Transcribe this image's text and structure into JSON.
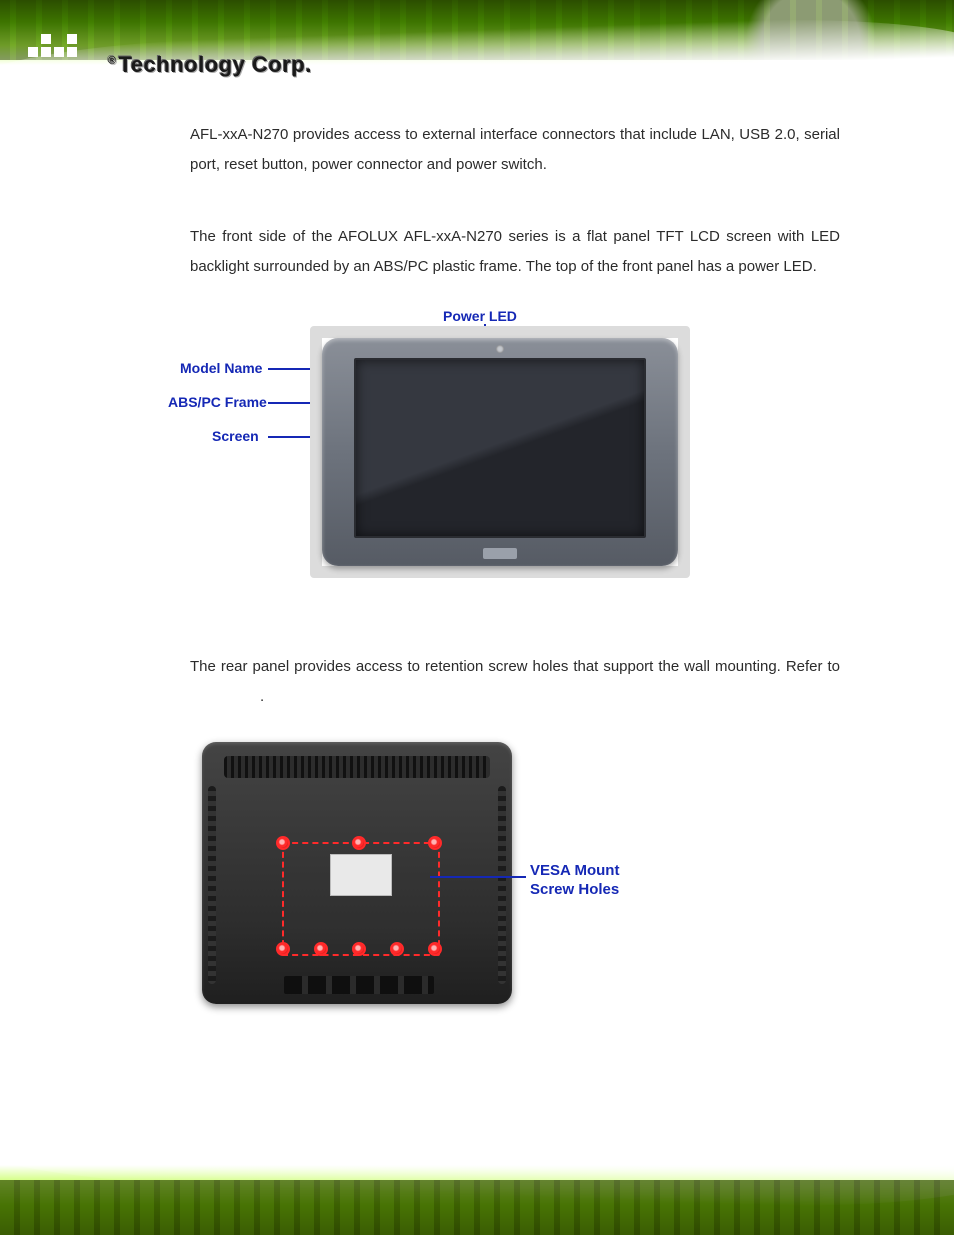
{
  "brand": {
    "name": "Technology Corp.",
    "reg": "®"
  },
  "paragraphs": {
    "intro": "AFL-xxA-N270 provides access to external interface connectors that include LAN, USB 2.0, serial port, reset button, power connector and power switch.",
    "front": "The front side of the AFOLUX AFL-xxA-N270 series is a flat panel TFT LCD screen with LED backlight surrounded by an ABS/PC plastic frame. The top of the front panel has a power LED.",
    "rear": "The rear panel provides access to retention screw holes that support the wall mounting. Refer to",
    "rear_tail": "."
  },
  "front_callouts": {
    "power_led": "Power LED",
    "model_name": "Model Name",
    "frame": "ABS/PC Frame",
    "screen": "Screen"
  },
  "rear_callouts": {
    "vesa_line1": "VESA Mount",
    "vesa_line2": "Screw Holes"
  }
}
